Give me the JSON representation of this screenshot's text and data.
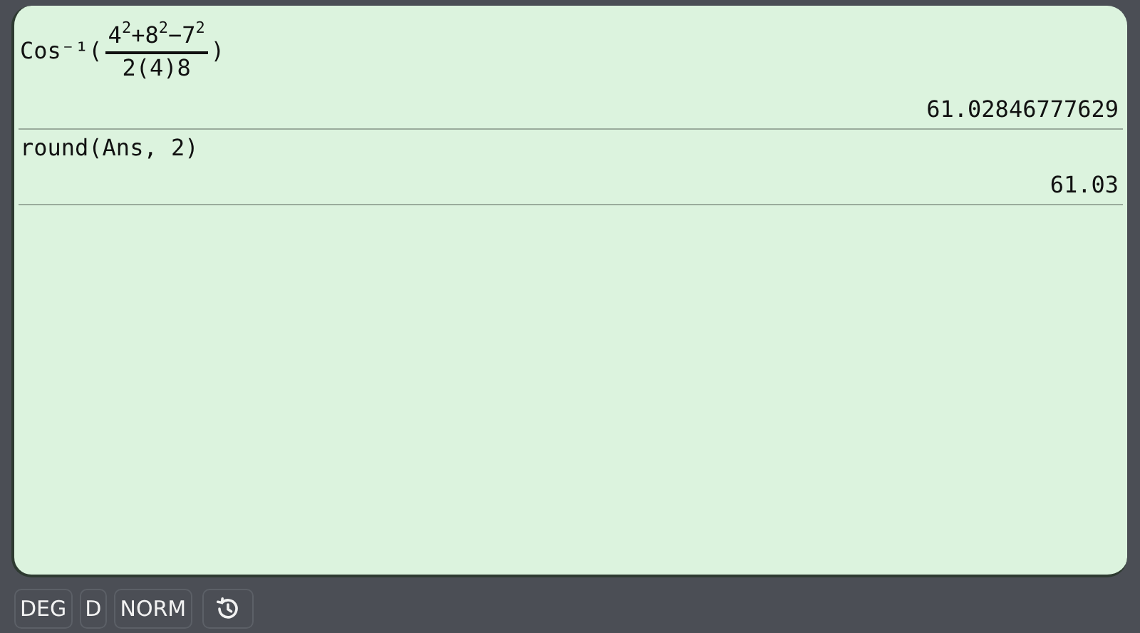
{
  "entries": [
    {
      "kind": "fraction",
      "prefix": "Cos⁻¹(",
      "numerator": "4$^{2}$+8$^{2}$−7$^{2}$",
      "denominator": "2(4)8",
      "suffix": ")",
      "result": "61.02846777629"
    },
    {
      "kind": "plain",
      "expression": "round(Ans, 2)",
      "result": "61.03"
    }
  ],
  "status_bar": {
    "buttons": [
      {
        "kind": "text",
        "label": "DEG"
      },
      {
        "kind": "text",
        "label": "D"
      },
      {
        "kind": "text",
        "label": "NORM"
      },
      {
        "kind": "history"
      }
    ]
  }
}
